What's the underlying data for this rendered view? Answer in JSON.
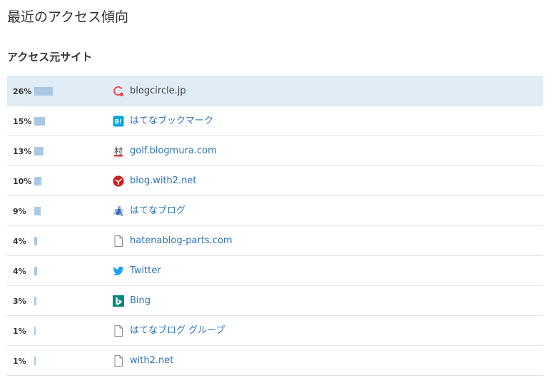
{
  "page_title": "最近のアクセス傾向",
  "section_title": "アクセス元サイト",
  "rows": [
    {
      "percent": "26%",
      "share": 0.26,
      "label": "blogcircle.jp",
      "icon": "blogcircle-icon",
      "linked": false,
      "highlight": true
    },
    {
      "percent": "15%",
      "share": 0.15,
      "label": "はてなブックマーク",
      "icon": "hatena-bookmark-icon",
      "linked": true,
      "highlight": false
    },
    {
      "percent": "13%",
      "share": 0.13,
      "label": "golf.blogmura.com",
      "icon": "blogmura-icon",
      "linked": true,
      "highlight": false
    },
    {
      "percent": "10%",
      "share": 0.1,
      "label": "blog.with2.net",
      "icon": "with2-icon",
      "linked": true,
      "highlight": false
    },
    {
      "percent": "9%",
      "share": 0.09,
      "label": "はてなブログ",
      "icon": "hatena-blog-icon",
      "linked": true,
      "highlight": false
    },
    {
      "percent": "4%",
      "share": 0.04,
      "label": "hatenablog-parts.com",
      "icon": "document-icon",
      "linked": true,
      "highlight": false
    },
    {
      "percent": "4%",
      "share": 0.04,
      "label": "Twitter",
      "icon": "twitter-icon",
      "linked": true,
      "highlight": false
    },
    {
      "percent": "3%",
      "share": 0.03,
      "label": "Bing",
      "icon": "bing-icon",
      "linked": true,
      "highlight": false
    },
    {
      "percent": "1%",
      "share": 0.01,
      "label": "はてなブログ グループ",
      "icon": "document-icon",
      "linked": true,
      "highlight": false
    },
    {
      "percent": "1%",
      "share": 0.01,
      "label": "with2.net",
      "icon": "document-icon",
      "linked": true,
      "highlight": false
    }
  ],
  "colors": {
    "bar": "#a9c8e4",
    "link": "#2f73b8",
    "highlight_row": "#e1edf6"
  }
}
